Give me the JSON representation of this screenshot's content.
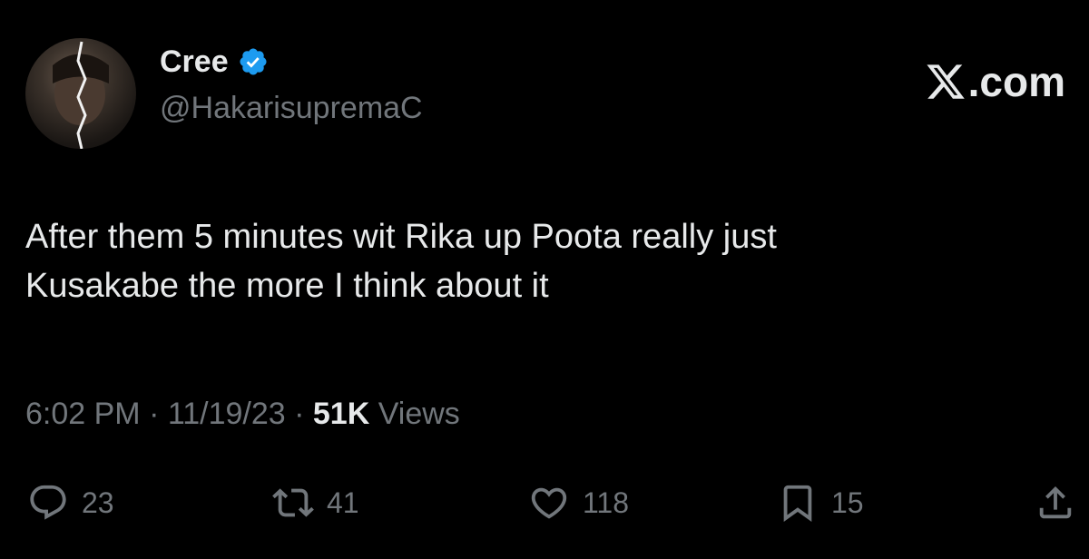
{
  "author": {
    "display_name": "Cree",
    "handle": "@HakarisupremaC",
    "verified_icon": "verified-badge-icon"
  },
  "brand": {
    "logo_icon": "x-logo-icon",
    "text": ".com"
  },
  "tweet": {
    "text_line1": "After them 5 minutes wit Rika up Poota really just",
    "text_line2": "Kusakabe the more I think about it"
  },
  "meta": {
    "time": "6:02 PM",
    "separator1": " · ",
    "date": "11/19/23",
    "separator2": " · ",
    "views_count": "51K",
    "views_label": " Views"
  },
  "actions": {
    "replies": "23",
    "reposts": "41",
    "likes": "118",
    "bookmarks": "15"
  },
  "colors": {
    "background": "#000000",
    "primary_text": "#e7e9ea",
    "secondary_text": "#71767b",
    "verified": "#1d9bf0"
  }
}
